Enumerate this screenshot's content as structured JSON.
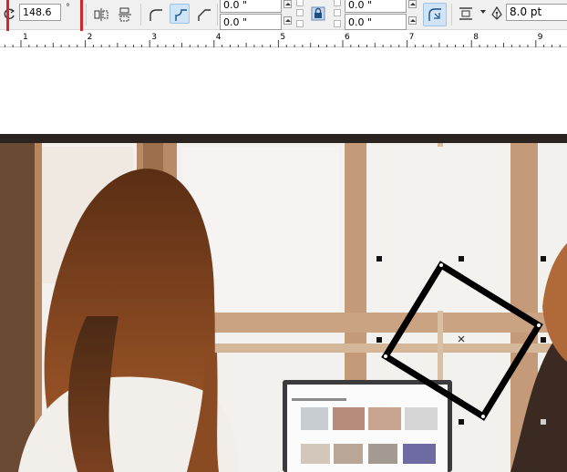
{
  "propbar": {
    "angle_value": "148.6",
    "angle_unit": "°",
    "offset_top_value": "0.0 \"",
    "offset_bottom_value": "0.0 \"",
    "offset2_top_value": "0.0 \"",
    "offset2_bottom_value": "0.0 \"",
    "outline_width": "8.0 pt"
  },
  "ruler": {
    "labels": [
      "1",
      "2",
      "3",
      "4",
      "5",
      "6",
      "7",
      "8",
      "9"
    ]
  },
  "colors": {
    "highlight": "#d4242c",
    "active_button": "#cfe4f7",
    "shape_outline": "#000000"
  },
  "icons": [
    "rotate-icon",
    "mirror-horizontal-icon",
    "mirror-vertical-icon",
    "corner-round-icon",
    "corner-scallop-icon",
    "corner-chamfer-icon",
    "lock-icon",
    "relative-corner-scaling-icon",
    "wrap-text-icon",
    "outline-pen-icon"
  ]
}
